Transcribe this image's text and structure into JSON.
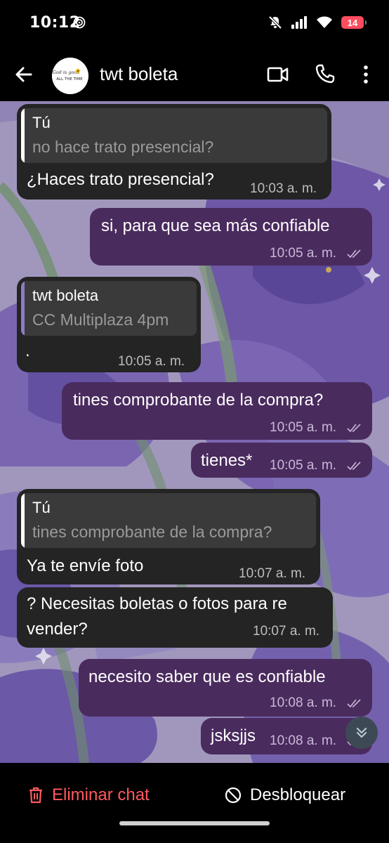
{
  "status_bar": {
    "time": "10:12",
    "battery": "14",
    "icons": [
      "hotspot-icon",
      "mute-icon",
      "signal-icon",
      "wifi-icon",
      "battery-icon"
    ]
  },
  "header": {
    "title": "twt boleta",
    "avatar_text_line1": "God is good",
    "avatar_text_line2": "ALL THE TIME",
    "icons": [
      "back-arrow-icon",
      "video-call-icon",
      "phone-icon",
      "more-vert-icon"
    ]
  },
  "messages": [
    {
      "direction": "in",
      "quote_author": "Tú",
      "quote_text": "no hace trato presencial?",
      "text": "¿Haces trato presencial?",
      "time": "10:03 a. m."
    },
    {
      "direction": "out",
      "text": "si, para que sea más confiable",
      "time": "10:05 a. m.",
      "read": true
    },
    {
      "direction": "in",
      "quote_author": "twt boleta",
      "quote_text": "CC Multiplaza 4pm",
      "text": ".",
      "time": "10:05 a. m."
    },
    {
      "direction": "out",
      "text": "tines comprobante de la compra?",
      "time": "10:05 a. m.",
      "read": true
    },
    {
      "direction": "out",
      "text": "tienes*",
      "time": "10:05 a. m.",
      "read": true
    },
    {
      "direction": "in",
      "quote_author": "Tú",
      "quote_text": "tines comprobante de la compra?",
      "text": "Ya te envíe foto",
      "time": "10:07 a. m."
    },
    {
      "direction": "in",
      "text": "? Necesitas boletas o fotos para re vender?",
      "time": "10:07 a. m."
    },
    {
      "direction": "out",
      "text": "necesito saber que es confiable",
      "time": "10:08 a. m.",
      "read": true
    },
    {
      "direction": "out",
      "text": "jsksjjs",
      "time": "10:08 a. m.",
      "read": true
    }
  ],
  "colors": {
    "incoming_bubble": "#242424",
    "outgoing_bubble": "#4a2b5e",
    "quote_bar_self": "#ffffff",
    "quote_bar_contact": "#8e7cc3",
    "delete_red": "#ff5a5f"
  },
  "bottom_bar": {
    "delete_label": "Eliminar chat",
    "unblock_label": "Desbloquear"
  }
}
